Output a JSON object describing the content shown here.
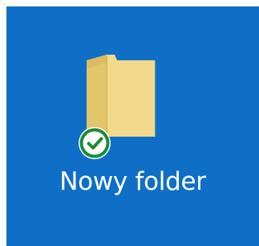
{
  "desktop": {
    "background_color": "#0f6fc6",
    "item": {
      "label": "Nowy folder",
      "icon": "folder-icon",
      "badge_icon": "sync-status-check-icon",
      "badge_color": "#1b8a3a"
    }
  }
}
